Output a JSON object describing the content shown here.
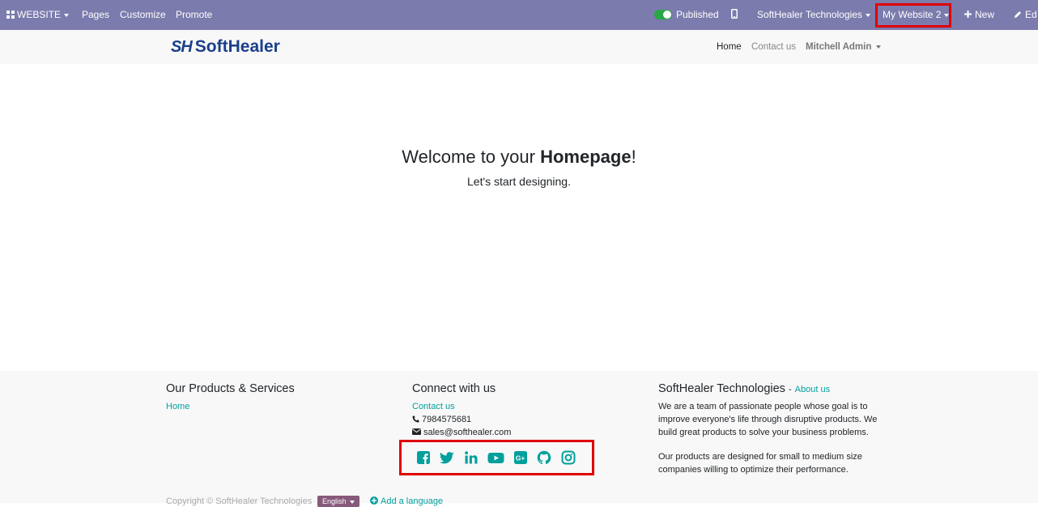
{
  "topbar": {
    "website_menu": "WEBSITE",
    "pages": "Pages",
    "customize": "Customize",
    "promote": "Promote",
    "published": "Published",
    "company": "SoftHealer Technologies",
    "website_switcher": "My Website 2",
    "new": "New",
    "edit": "Ed"
  },
  "header": {
    "logo_mark": "SH",
    "logo_text": "SoftHealer",
    "nav": {
      "home": "Home",
      "contact": "Contact us",
      "user": "Mitchell Admin"
    }
  },
  "hero": {
    "title_prefix": "Welcome to your ",
    "title_bold": "Homepage",
    "title_suffix": "!",
    "subtitle": "Let's start designing."
  },
  "footer": {
    "products": {
      "heading": "Our Products & Services",
      "links": [
        "Home"
      ]
    },
    "connect": {
      "heading": "Connect with us",
      "contact_link": "Contact us",
      "phone": "7984575681",
      "email": "sales@softhealer.com",
      "social_icons": [
        "facebook-icon",
        "twitter-icon",
        "linkedin-icon",
        "youtube-icon",
        "google-plus-icon",
        "github-icon",
        "instagram-icon"
      ]
    },
    "about": {
      "heading": "SoftHealer Technologies",
      "separator": "-",
      "about_link": "About us",
      "paragraph1": "We are a team of passionate people whose goal is to improve everyone's life through disruptive products. We build great products to solve your business problems.",
      "paragraph2": "Our products are designed for small to medium size companies willing to optimize their performance."
    },
    "copyright": "Copyright © SoftHealer Technologies",
    "language": "English",
    "add_language": "Add a language"
  },
  "colors": {
    "topbar_bg": "#7c7bad",
    "accent_teal": "#00a09d",
    "highlight_red": "#e00000",
    "logo_blue": "#1a3f8b",
    "language_badge": "#875a7b"
  }
}
